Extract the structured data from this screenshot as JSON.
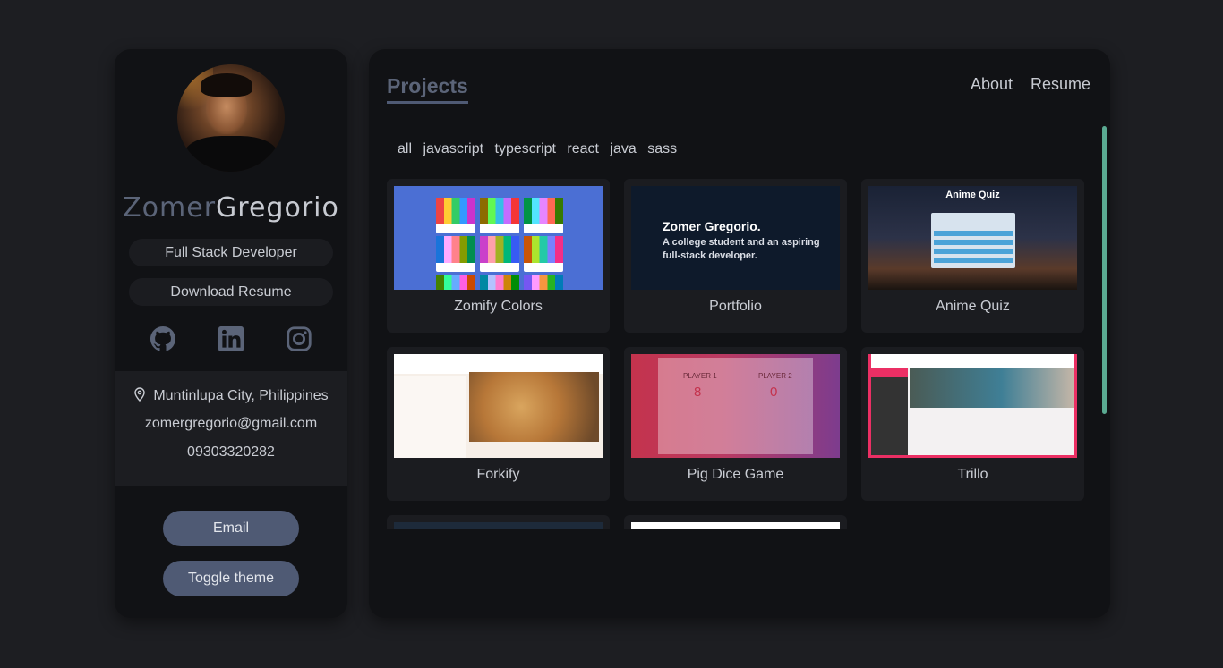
{
  "profile": {
    "first_name": "Zomer",
    "last_name": "Gregorio",
    "role": "Full Stack Developer",
    "download_label": "Download Resume",
    "socials": [
      {
        "name": "github-icon"
      },
      {
        "name": "linkedin-icon"
      },
      {
        "name": "instagram-icon"
      }
    ],
    "location": "Muntinlupa City, Philippines",
    "email": "zomergregorio@gmail.com",
    "phone": "09303320282",
    "email_button": "Email",
    "theme_button": "Toggle theme"
  },
  "header": {
    "title": "Projects",
    "nav": [
      "About",
      "Resume"
    ]
  },
  "filters": [
    "all",
    "javascript",
    "typescript",
    "react",
    "java",
    "sass"
  ],
  "projects": [
    {
      "label": "Zomify Colors"
    },
    {
      "label": "Portfolio",
      "thumb_heading": "Zomer Gregorio.",
      "thumb_text": "A college student and an aspiring full-stack developer."
    },
    {
      "label": "Anime Quiz",
      "thumb_heading": "Anime Quiz"
    },
    {
      "label": "Forkify"
    },
    {
      "label": "Pig Dice Game",
      "player1": "PLAYER 1",
      "player2": "PLAYER 2",
      "score1": "8",
      "score2": "0"
    },
    {
      "label": "Trillo"
    }
  ],
  "colors": {
    "background": "#1d1e22",
    "panel": "#111215",
    "accent": "#4f5a74",
    "scrollbar": "#5aa991"
  }
}
